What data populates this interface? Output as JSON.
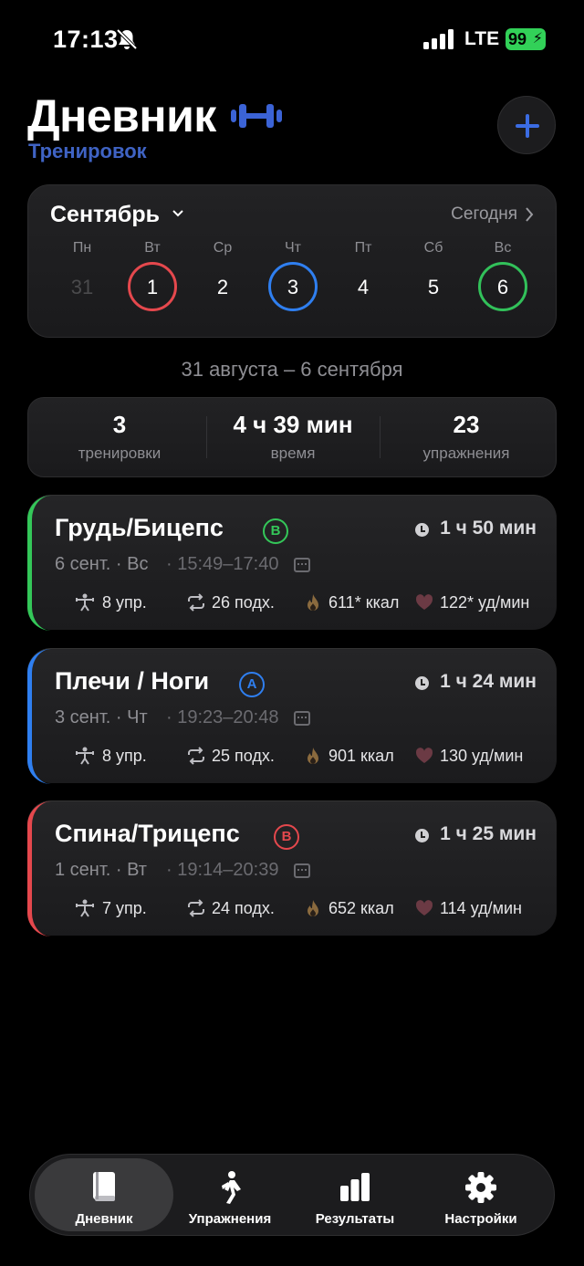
{
  "status": {
    "time": "17:13",
    "network": "LTE",
    "battery": "99"
  },
  "header": {
    "title": "Дневник",
    "subtitle": "Тренировок"
  },
  "calendar": {
    "month": "Сентябрь",
    "today_label": "Сегодня",
    "weekdays": [
      "Пн",
      "Вт",
      "Ср",
      "Чт",
      "Пт",
      "Сб",
      "Вс"
    ],
    "days": [
      "31",
      "1",
      "2",
      "3",
      "4",
      "5",
      "6"
    ],
    "day_ring_colors": [
      "",
      "#e5484d",
      "",
      "#2f7ff0",
      "",
      "",
      "#32c15a"
    ]
  },
  "range": "31 августа – 6 сентября",
  "summary": [
    {
      "value": "3",
      "label": "тренировки"
    },
    {
      "value": "4 ч 39 мин",
      "label": "время"
    },
    {
      "value": "23",
      "label": "упражнения"
    }
  ],
  "workouts": [
    {
      "name": "Грудь/Бицепс",
      "badge": "B",
      "color": "#34c759",
      "duration": "1 ч 50 мин",
      "date": "6 сент. · Вс",
      "time": "15:49–17:40",
      "exercises": "8 упр.",
      "sets": "26 подх.",
      "kcal": "611* ккал",
      "hr": "122* уд/мин"
    },
    {
      "name": "Плечи / Ноги",
      "badge": "A",
      "color": "#2f7ff0",
      "duration": "1 ч 24 мин",
      "date": "3 сент. · Чт",
      "time": "19:23–20:48",
      "exercises": "8 упр.",
      "sets": "25 подх.",
      "kcal": "901 ккал",
      "hr": "130 уд/мин"
    },
    {
      "name": "Спина/Трицепс",
      "badge": "B",
      "color": "#e5484d",
      "duration": "1 ч 25 мин",
      "date": "1 сент. · Вт",
      "time": "19:14–20:39",
      "exercises": "7 упр.",
      "sets": "24 подх.",
      "kcal": "652 ккал",
      "hr": "114 уд/мин"
    }
  ],
  "tabs": [
    {
      "label": "Дневник",
      "icon": "book-icon",
      "active": true
    },
    {
      "label": "Упражнения",
      "icon": "walking-figure-icon",
      "active": false
    },
    {
      "label": "Результаты",
      "icon": "bar-chart-icon",
      "active": false
    },
    {
      "label": "Настройки",
      "icon": "gear-icon",
      "active": false
    }
  ]
}
